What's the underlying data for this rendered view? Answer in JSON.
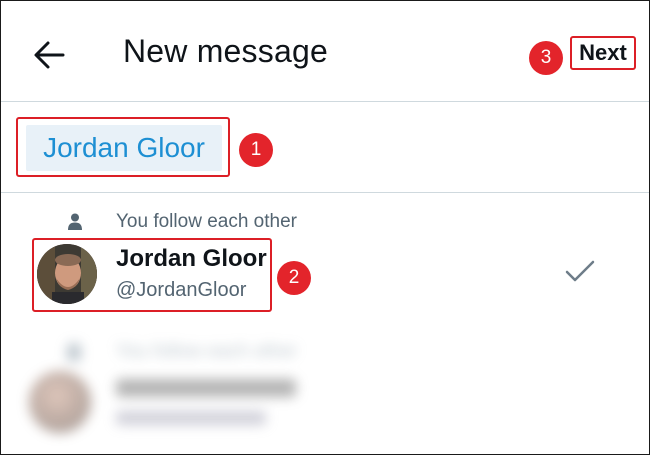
{
  "header": {
    "title": "New message",
    "next_label": "Next"
  },
  "recipient": {
    "chip_label": "Jordan Gloor"
  },
  "results": [
    {
      "relation": "You follow each other",
      "name": "Jordan Gloor",
      "handle": "@JordanGloor",
      "selected": true
    }
  ],
  "blurred_result": {
    "relation": "You follow each other"
  },
  "annotations": {
    "badge_1": "1",
    "badge_2": "2",
    "badge_3": "3",
    "highlight_color": "#dc1f26",
    "badge_color": "#e3242b"
  },
  "colors": {
    "accent": "#1d8fd3",
    "chip_background": "#e8f1f8",
    "secondary_text": "#536471",
    "divider": "#cfd9de"
  },
  "icons": {
    "back": "arrow-left-icon",
    "follow": "person-icon",
    "selected": "check-icon"
  }
}
